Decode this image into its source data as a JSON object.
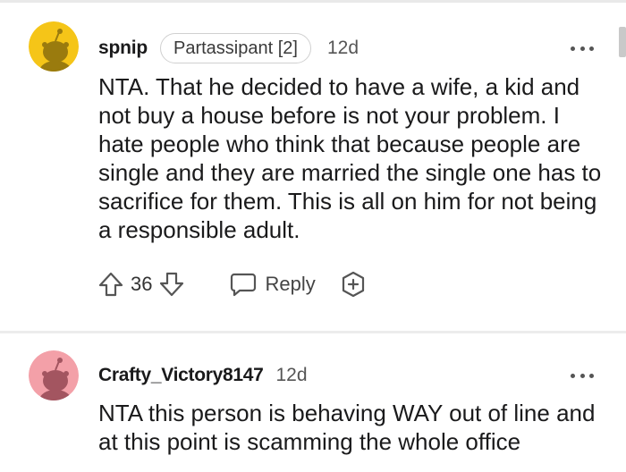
{
  "comments": [
    {
      "username": "spnip",
      "flair": "Partassipant [2]",
      "age": "12d",
      "avatar_color": "#f5c518",
      "body": "NTA. That he decided to have a wife, a kid and not buy a house before is not your problem. I hate people who think that because people are single and they are married the single one has to sacrifice for them. This is all on him for not being a responsible adult.",
      "score": "36",
      "reply_label": "Reply",
      "icons": [
        "upvote-icon",
        "downvote-icon",
        "reply-bubble-icon",
        "award-icon",
        "more-options-icon"
      ]
    },
    {
      "username": "Crafty_Victory8147",
      "age": "12d",
      "avatar_color": "#f3a0a8",
      "body": "NTA this person is behaving WAY out of line and at this point is scamming the whole office",
      "icons": [
        "more-options-icon"
      ]
    }
  ],
  "colors": {
    "text": "#1a1a1b",
    "muted": "#555555",
    "divider": "#ececec"
  }
}
